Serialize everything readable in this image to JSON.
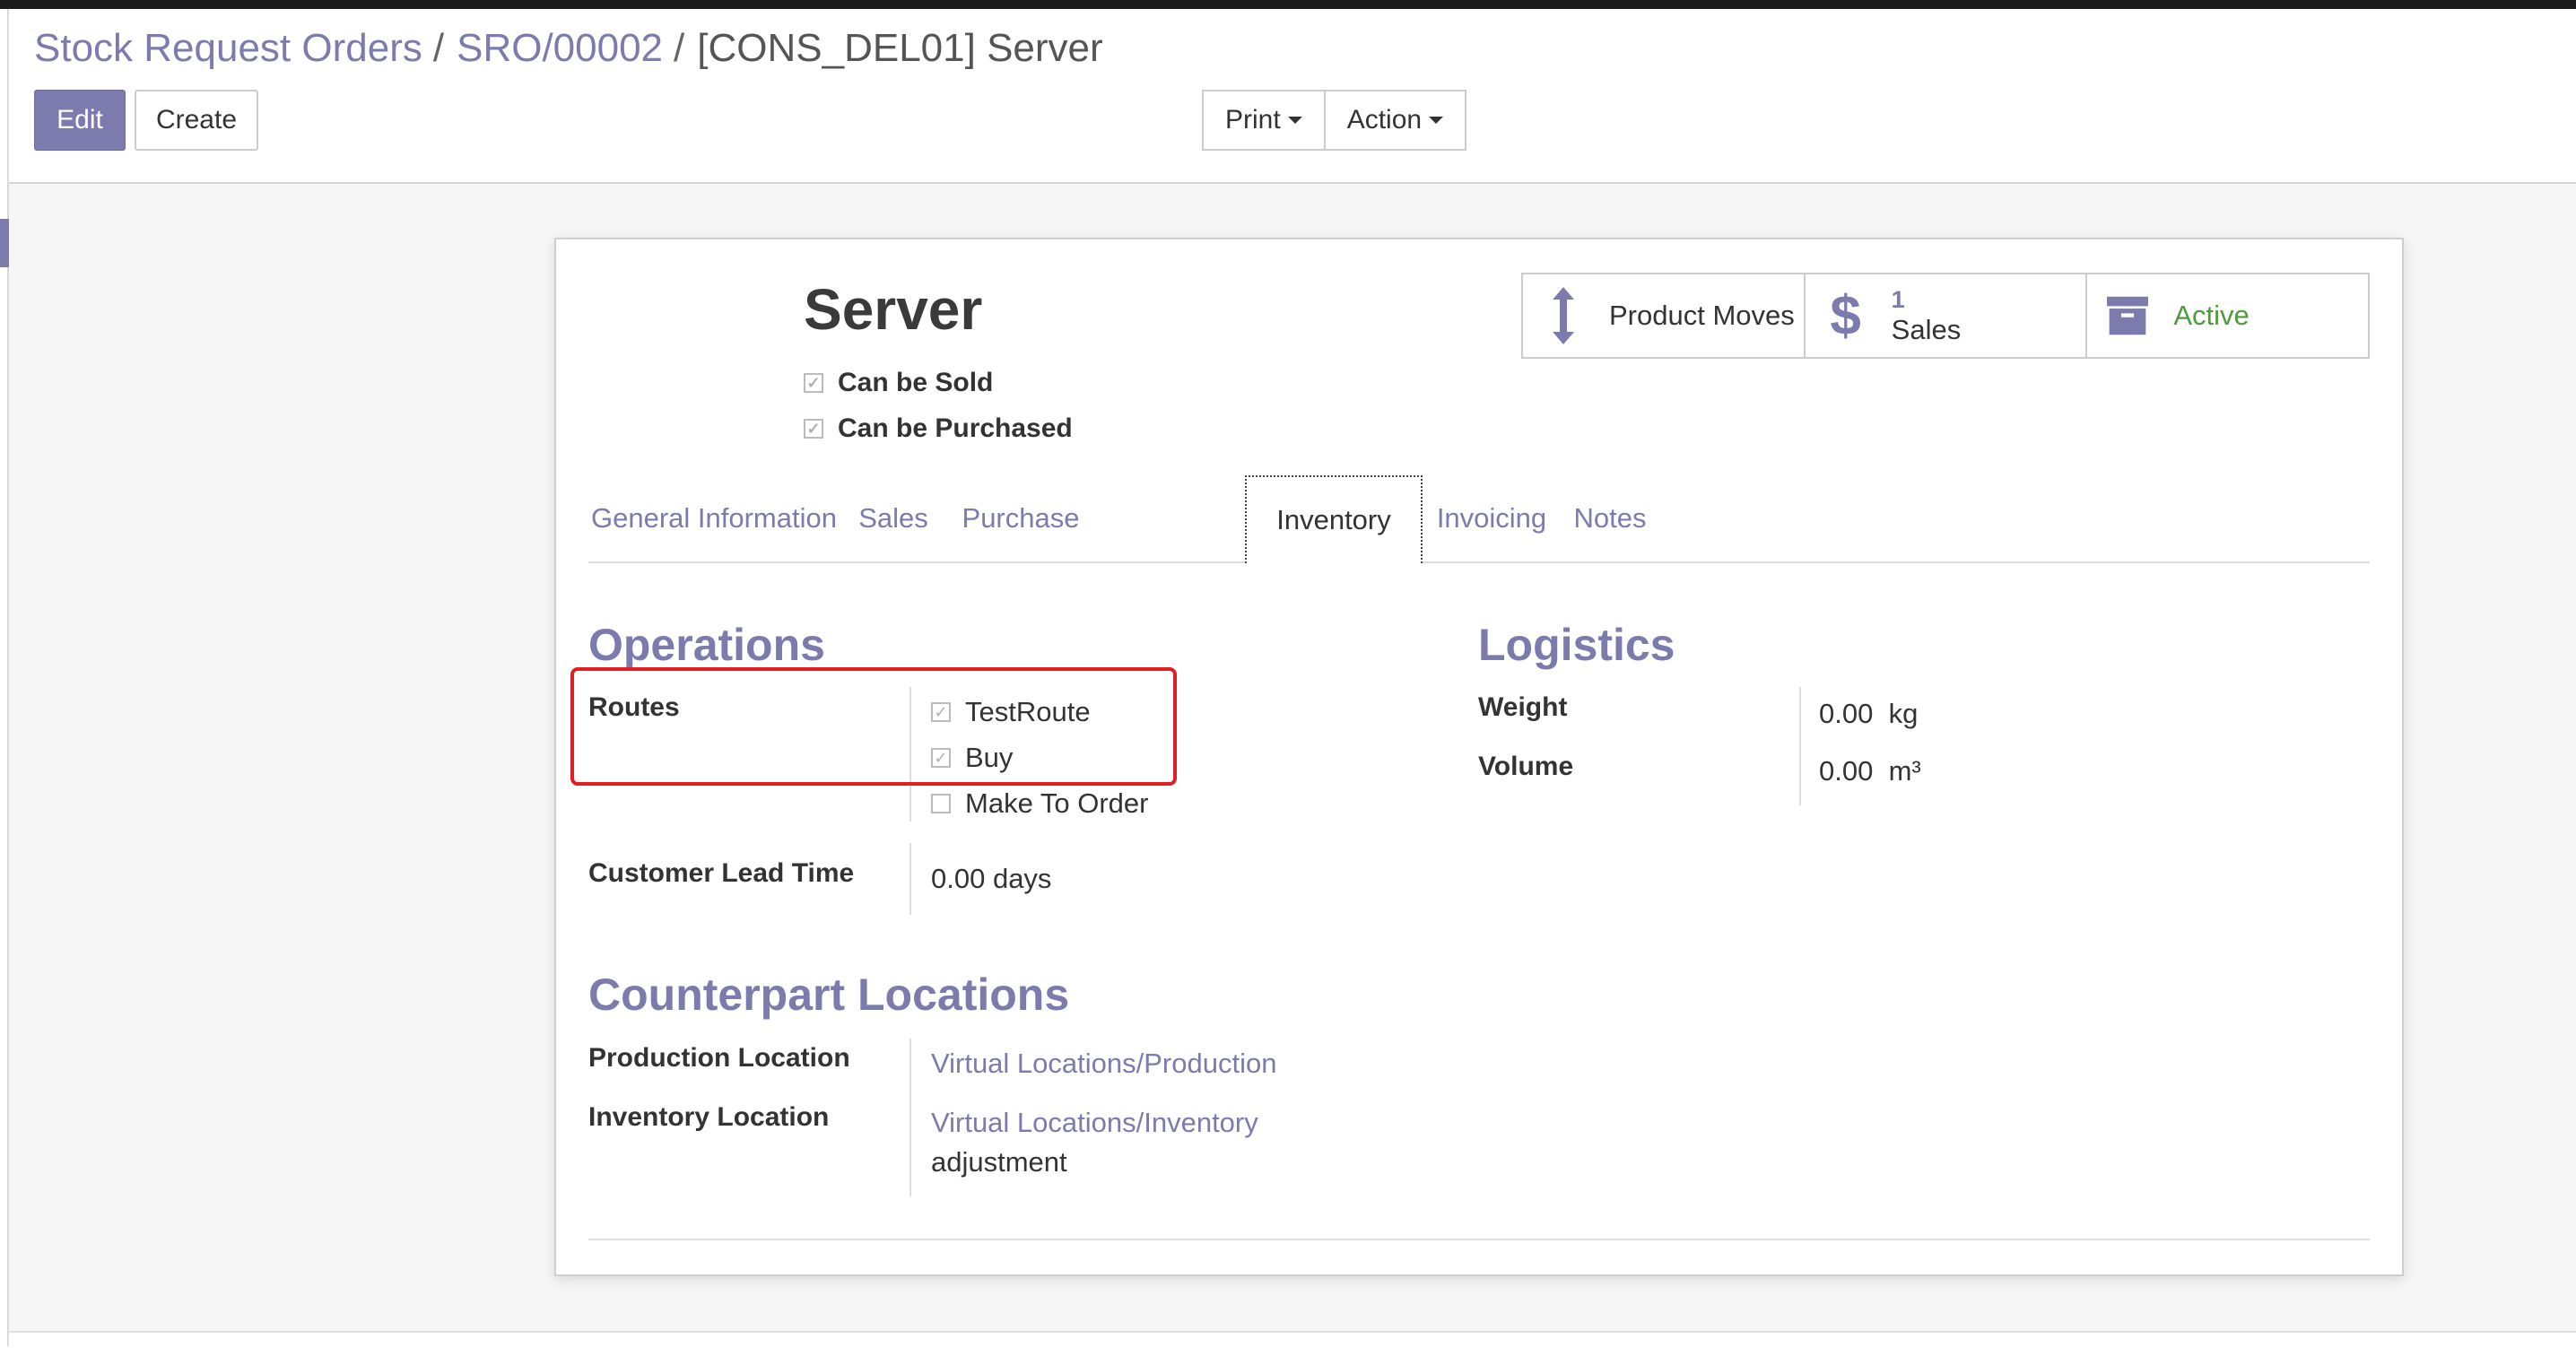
{
  "breadcrumb": {
    "items": [
      "Stock Request Orders",
      "SRO/00002"
    ],
    "current": "[CONS_DEL01] Server",
    "separator": "/"
  },
  "toolbar": {
    "edit_label": "Edit",
    "create_label": "Create",
    "print_label": "Print",
    "action_label": "Action"
  },
  "product": {
    "name": "Server",
    "can_be_sold_label": "Can be Sold",
    "can_be_sold": true,
    "can_be_purchased_label": "Can be Purchased",
    "can_be_purchased": true
  },
  "smart_buttons": {
    "product_moves_label": "Product Moves",
    "sales_count": "1",
    "sales_label": "Sales",
    "active_label": "Active"
  },
  "tabs": [
    "General Information",
    "Sales",
    "Purchase",
    "Inventory",
    "Invoicing",
    "Notes"
  ],
  "active_tab": "Inventory",
  "operations": {
    "title": "Operations",
    "routes_label": "Routes",
    "routes": [
      {
        "label": "TestRoute",
        "checked": true
      },
      {
        "label": "Buy",
        "checked": true
      },
      {
        "label": "Make To Order",
        "checked": false
      }
    ],
    "lead_time_label": "Customer Lead Time",
    "lead_time_value": "0.00 days"
  },
  "logistics": {
    "title": "Logistics",
    "weight_label": "Weight",
    "weight_value": "0.00",
    "weight_unit": "kg",
    "volume_label": "Volume",
    "volume_value": "0.00",
    "volume_unit": "m³"
  },
  "counterpart": {
    "title": "Counterpart Locations",
    "production_label": "Production Location",
    "production_value": "Virtual Locations/Production",
    "inventory_label": "Inventory Location",
    "inventory_value": "Virtual Locations/Inventory",
    "inventory_value_line2": "adjustment"
  },
  "colors": {
    "brand": "#7c7bad",
    "highlight_box": "#e02020",
    "active_status": "#4f9a3e"
  },
  "icons": {
    "product_moves": "vertical-arrows-icon",
    "sales": "dollar-icon",
    "active": "archive-icon",
    "checkbox": "checkbox-icon"
  }
}
